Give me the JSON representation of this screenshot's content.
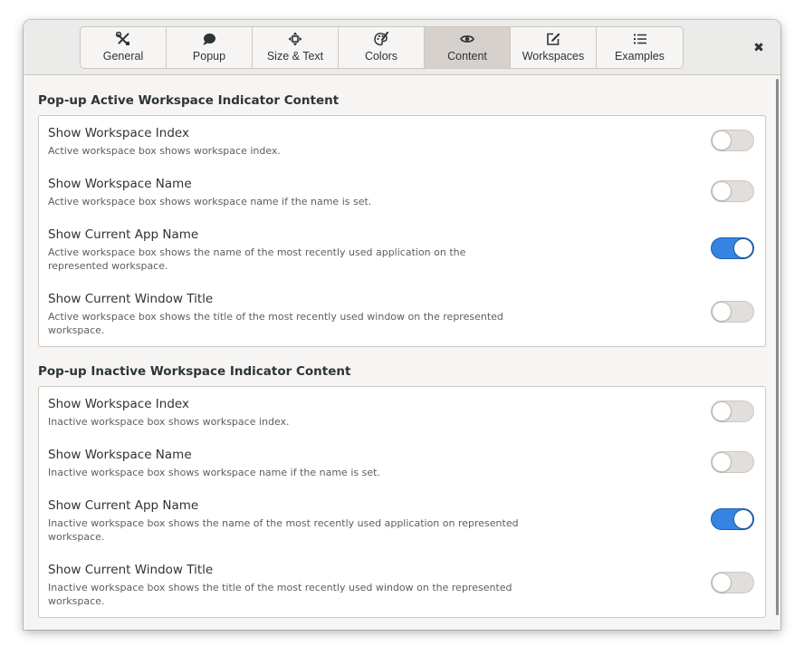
{
  "window": {
    "tabs": [
      {
        "label": "General",
        "icon": "tools-icon",
        "active": false
      },
      {
        "label": "Popup",
        "icon": "speech-bubble-icon",
        "active": false
      },
      {
        "label": "Size & Text",
        "icon": "move-arrows-icon",
        "active": false
      },
      {
        "label": "Colors",
        "icon": "palette-icon",
        "active": false
      },
      {
        "label": "Content",
        "icon": "eye-icon",
        "active": true
      },
      {
        "label": "Workspaces",
        "icon": "edit-icon",
        "active": false
      },
      {
        "label": "Examples",
        "icon": "list-icon",
        "active": false
      }
    ],
    "close_icon": "close-icon",
    "close_glyph": "✖"
  },
  "active_section": {
    "title": "Pop-up Active Workspace Indicator Content",
    "rows": [
      {
        "title": "Show Workspace Index",
        "subtitle": "Active workspace box shows workspace index.",
        "enabled": false
      },
      {
        "title": "Show Workspace Name",
        "subtitle": "Active workspace box shows workspace name if the name is set.",
        "enabled": false
      },
      {
        "title": "Show Current App Name",
        "subtitle": "Active workspace box shows the name of the most recently used application on the represented workspace.",
        "enabled": true
      },
      {
        "title": "Show Current Window Title",
        "subtitle": "Active workspace box shows the title of the most recently used window on the represented workspace.",
        "enabled": false
      }
    ]
  },
  "inactive_section": {
    "title": "Pop-up Inactive Workspace Indicator Content",
    "rows": [
      {
        "title": "Show Workspace Index",
        "subtitle": "Inactive workspace box shows workspace index.",
        "enabled": false
      },
      {
        "title": "Show Workspace Name",
        "subtitle": "Inactive workspace box shows workspace name if the name is set.",
        "enabled": false
      },
      {
        "title": "Show Current App Name",
        "subtitle": "Inactive workspace box shows the name of the most recently used application on represented workspace.",
        "enabled": true
      },
      {
        "title": "Show Current Window Title",
        "subtitle": "Inactive workspace box shows the title of the most recently used window on the represented workspace.",
        "enabled": false
      }
    ]
  },
  "colors": {
    "accent": "#3584e4",
    "window_bg": "#f6f5f4",
    "frame_bg": "#ffffff",
    "active_tab_bg": "#d6d1cd"
  }
}
